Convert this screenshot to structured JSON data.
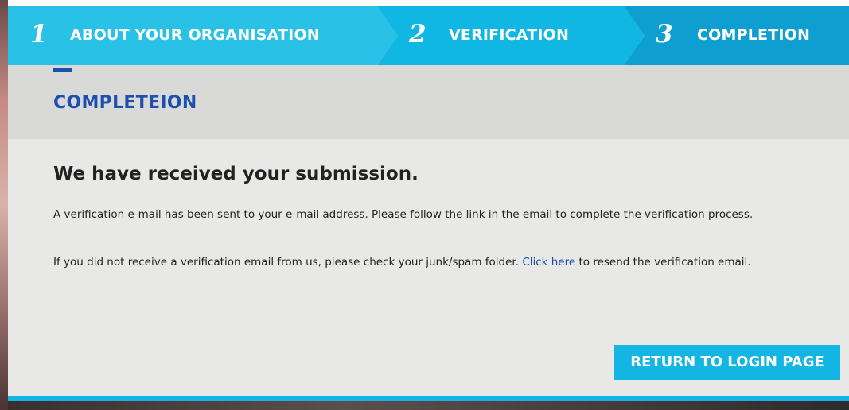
{
  "steps": [
    {
      "number": "1",
      "label": "ABOUT YOUR ORGANISATION"
    },
    {
      "number": "2",
      "label": "VERIFICATION"
    },
    {
      "number": "3",
      "label": "COMPLETION"
    }
  ],
  "section": {
    "title": "COMPLETEION"
  },
  "message": {
    "headline": "We have received your submission.",
    "paragraph_1": "A verification e-mail has been sent to your e-mail address. Please follow the link in the email to complete the verification process.",
    "paragraph_2_before": "If you did not receive a verification email from us, please check your junk/spam folder. ",
    "paragraph_2_link": "Click here",
    "paragraph_2_after": " to resend the verification email."
  },
  "actions": {
    "return_label": "RETURN TO LOGIN PAGE"
  },
  "colors": {
    "step_1": "#29c1e6",
    "step_2": "#10b7e2",
    "step_3": "#0e9ed0",
    "title_blue": "#1d4fae",
    "link_blue": "#1c4ea7",
    "button": "#13b5e3"
  }
}
